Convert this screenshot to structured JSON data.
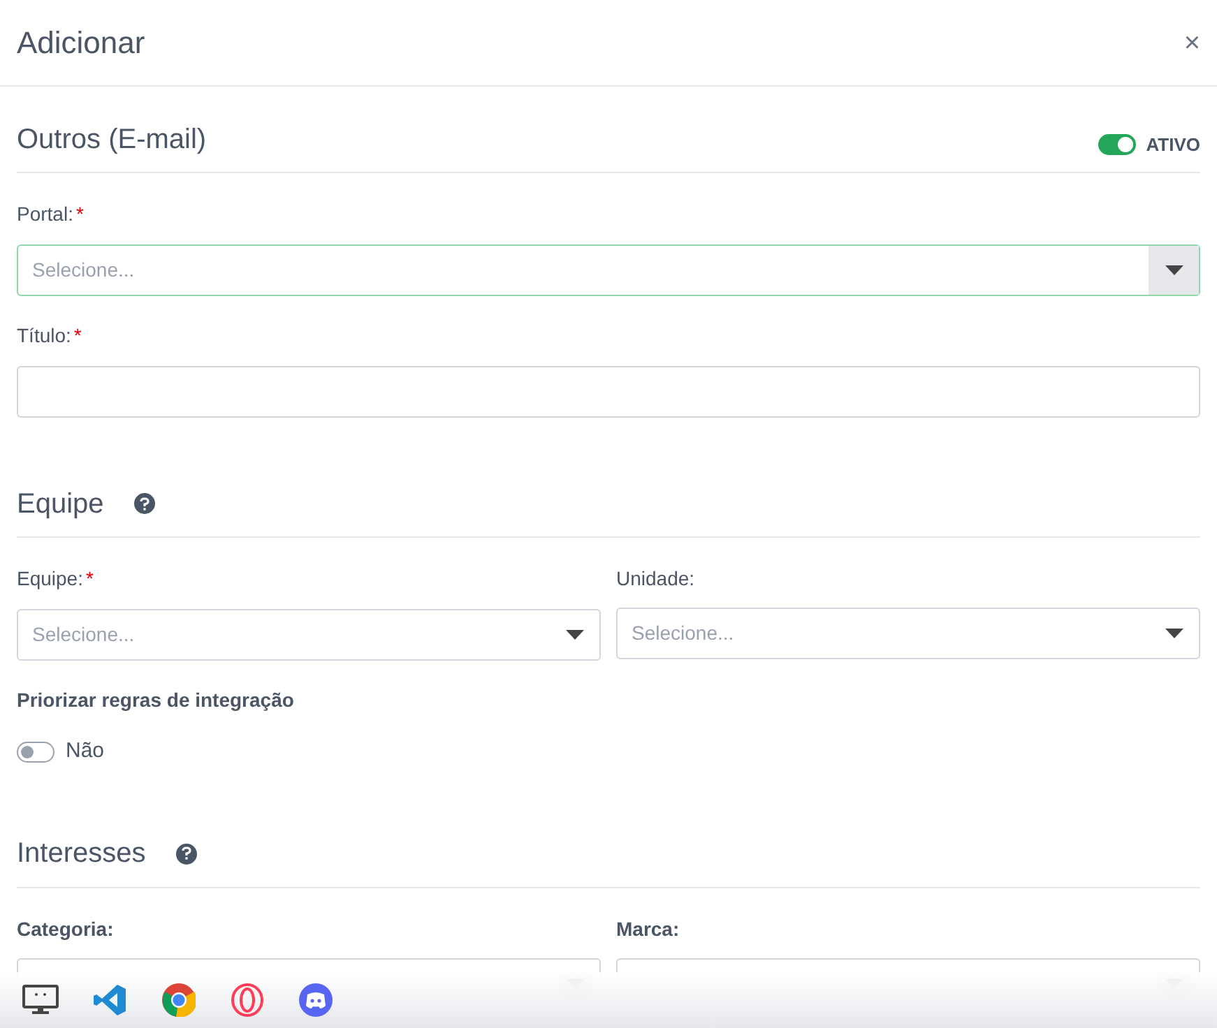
{
  "dialog": {
    "title": "Adicionar",
    "close": "×"
  },
  "sections": [
    {
      "title": "Outros (E-mail)",
      "help": false,
      "status_toggle": {
        "on": true,
        "label": "ATIVO"
      },
      "rows": [
        [
          {
            "kind": "select",
            "label": "Portal:",
            "required_mark": "*",
            "label_bold": false,
            "placeholder": "Selecione...",
            "focused": true
          }
        ],
        [
          {
            "kind": "text",
            "label": "Título:",
            "required_mark": "*",
            "label_bold": false,
            "focused": false
          }
        ]
      ]
    },
    {
      "title": "Equipe",
      "help": true,
      "rows": [
        [
          {
            "kind": "select",
            "label": "Equipe:",
            "required_mark": "*",
            "label_bold": false,
            "placeholder": "Selecione...",
            "focused": false
          },
          {
            "kind": "select",
            "label": "Unidade:",
            "label_bold": false,
            "placeholder": "Selecione...",
            "focused": false
          }
        ],
        [
          {
            "kind": "switch",
            "label": "Priorizar regras de integração",
            "label_bold": true,
            "on": false,
            "value": "Não"
          }
        ]
      ]
    },
    {
      "title": "Interesses",
      "help": true,
      "rows": [
        [
          {
            "kind": "select",
            "label": "Categoria:",
            "label_bold": true,
            "focused": false
          },
          {
            "kind": "select",
            "label": "Marca:",
            "label_bold": true,
            "focused": false
          }
        ]
      ]
    }
  ]
}
